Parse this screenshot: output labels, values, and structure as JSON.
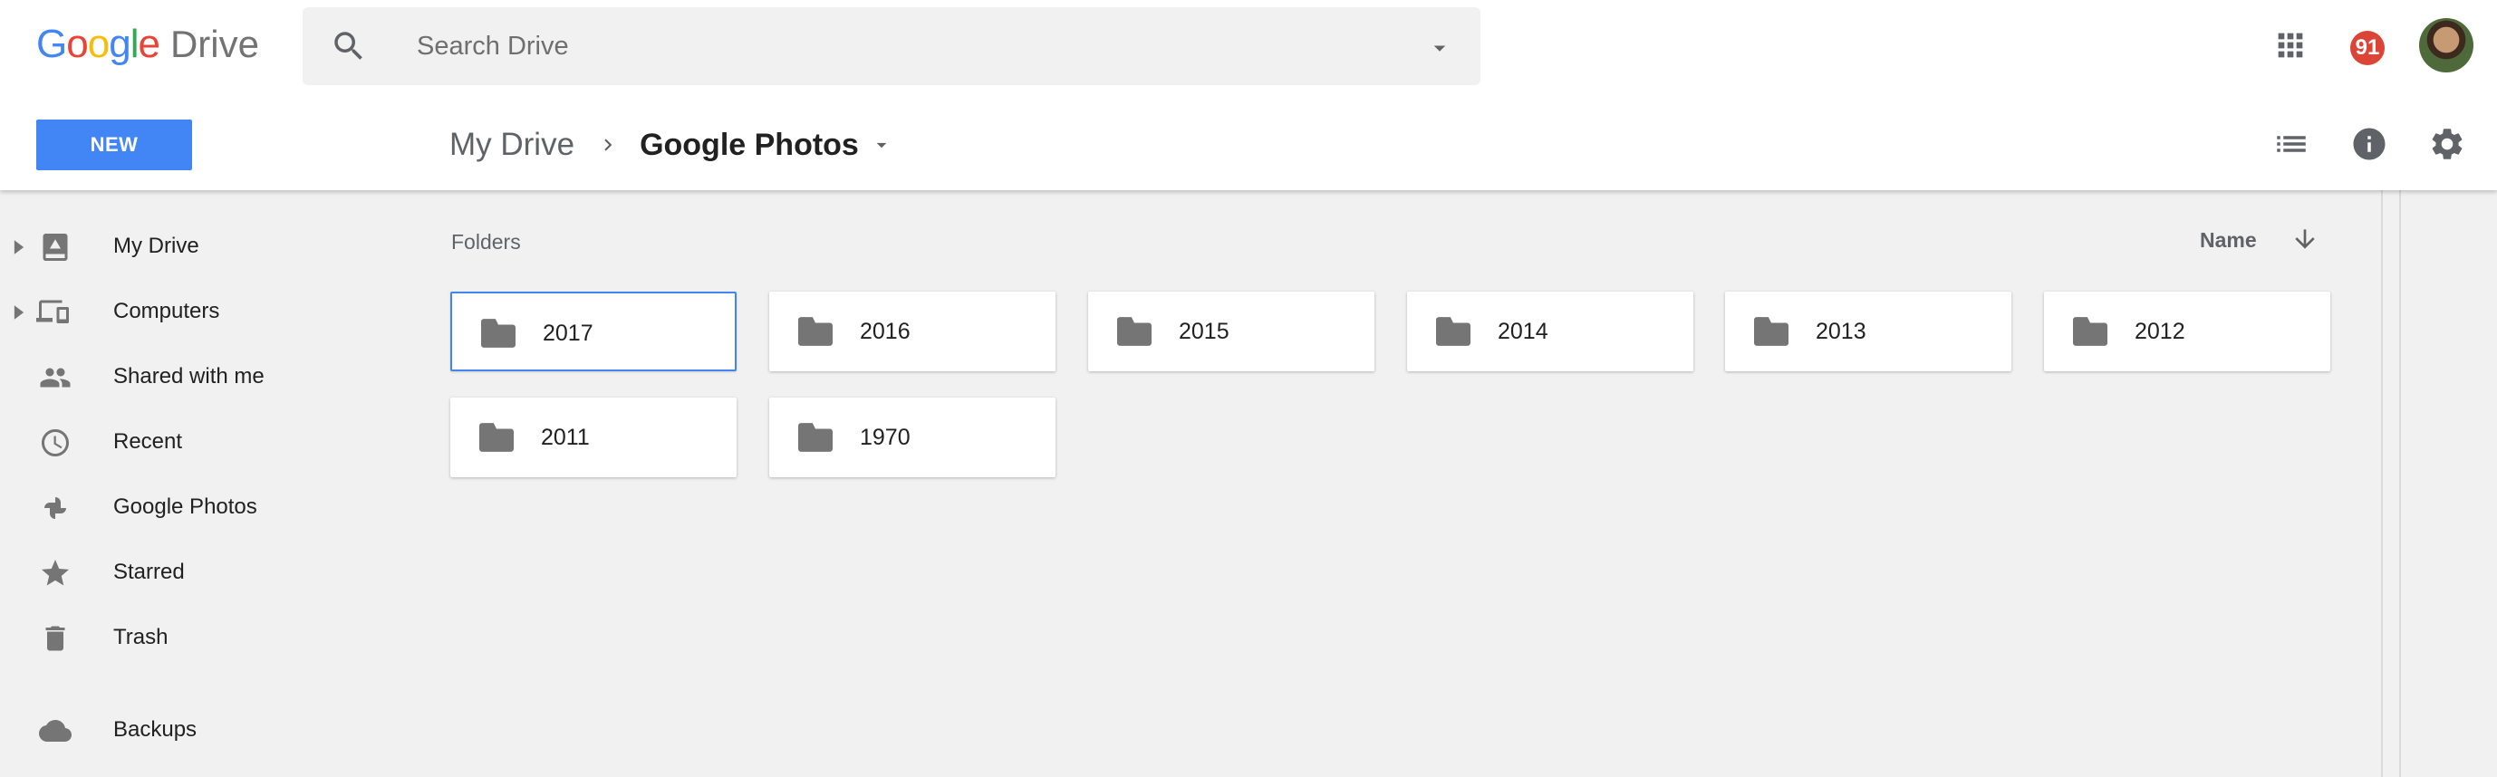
{
  "app": {
    "logo_google": [
      "G",
      "o",
      "o",
      "g",
      "l",
      "e"
    ],
    "logo_product": "Drive"
  },
  "search": {
    "placeholder": "Search Drive",
    "value": ""
  },
  "header": {
    "notifications_count": "91",
    "new_button_label": "NEW"
  },
  "breadcrumb": {
    "root": "My Drive",
    "current": "Google Photos"
  },
  "sidebar": {
    "items": [
      {
        "label": "My Drive",
        "icon": "my-drive-icon",
        "expandable": true
      },
      {
        "label": "Computers",
        "icon": "computers-icon",
        "expandable": true
      },
      {
        "label": "Shared with me",
        "icon": "people-icon",
        "expandable": false
      },
      {
        "label": "Recent",
        "icon": "clock-icon",
        "expandable": false
      },
      {
        "label": "Google Photos",
        "icon": "pinwheel-icon",
        "expandable": false
      },
      {
        "label": "Starred",
        "icon": "star-icon",
        "expandable": false
      },
      {
        "label": "Trash",
        "icon": "trash-icon",
        "expandable": false
      },
      {
        "label": "Backups",
        "icon": "cloud-icon",
        "expandable": false
      }
    ]
  },
  "main": {
    "section_title": "Folders",
    "sort_label": "Name",
    "sort_direction": "descending",
    "folders": [
      {
        "name": "2017",
        "selected": true
      },
      {
        "name": "2016",
        "selected": false
      },
      {
        "name": "2015",
        "selected": false
      },
      {
        "name": "2014",
        "selected": false
      },
      {
        "name": "2013",
        "selected": false
      },
      {
        "name": "2012",
        "selected": false
      },
      {
        "name": "2011",
        "selected": false
      },
      {
        "name": "1970",
        "selected": false
      }
    ]
  },
  "colors": {
    "accent": "#4285f4",
    "badge": "#db4437",
    "icon_grey": "#757575",
    "background": "#f1f1f1"
  }
}
